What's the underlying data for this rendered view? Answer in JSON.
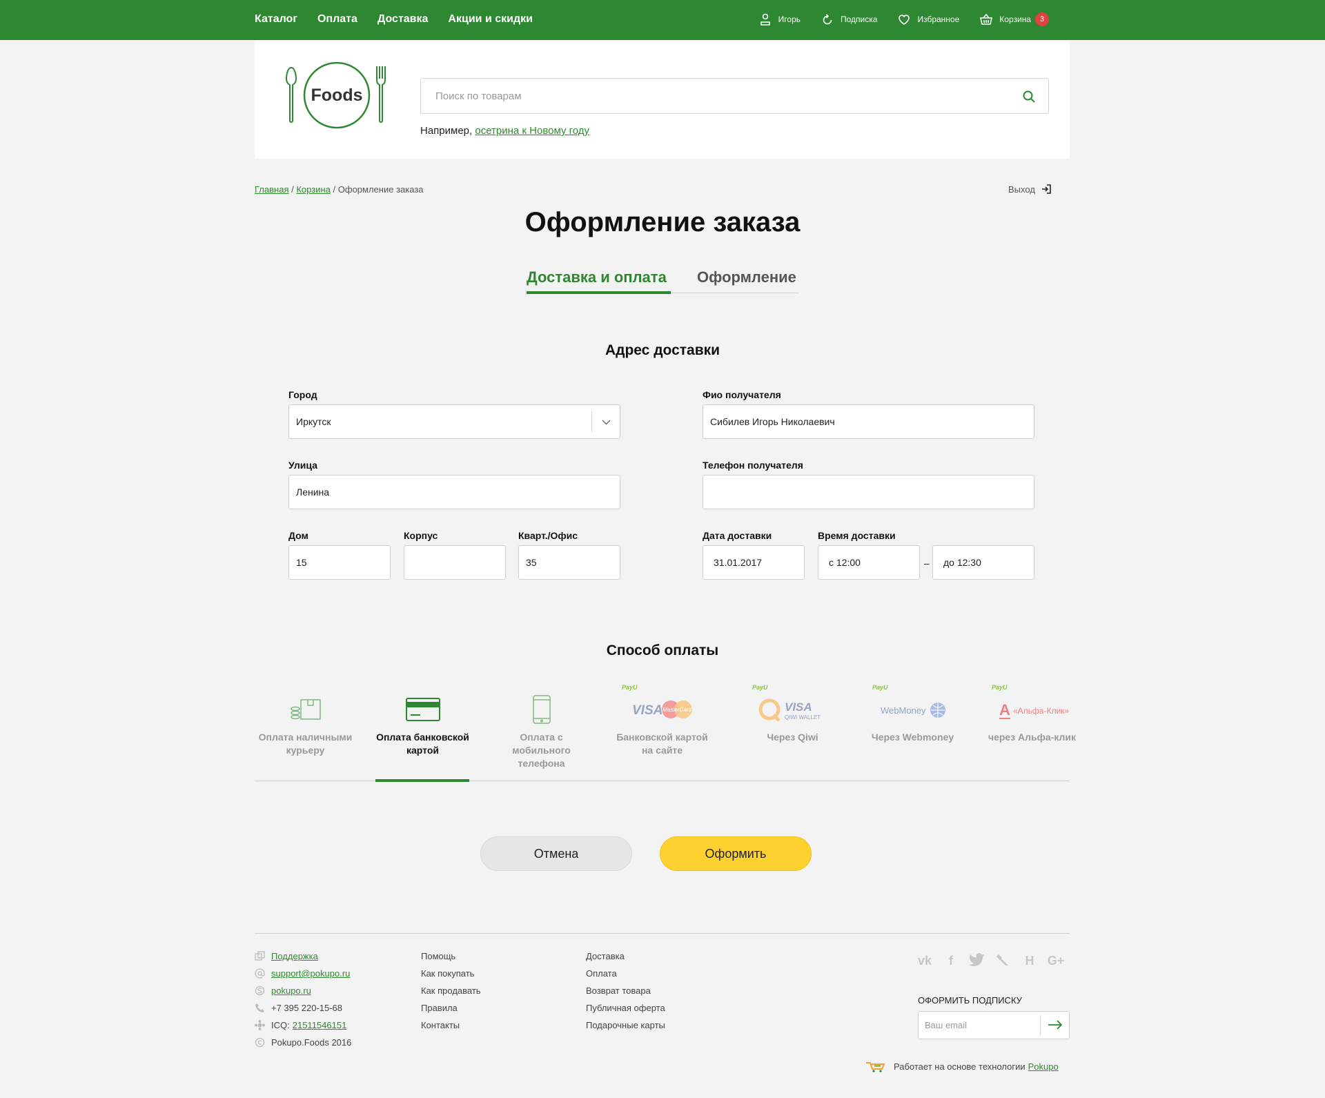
{
  "topbar": {
    "nav": [
      "Каталог",
      "Оплата",
      "Доставка",
      "Акции и скидки"
    ],
    "user": "Игорь",
    "subscription": "Подписка",
    "favorites": "Избранное",
    "cart": "Корзина",
    "cart_count": "3"
  },
  "header": {
    "logo_text": "Foods",
    "search_placeholder": "Поиск по товарам",
    "example_prefix": "Например,",
    "example_link": "осетрина к Новому году"
  },
  "breadcrumb": {
    "home": "Главная",
    "cart": "Корзина",
    "current": "Оформление заказа",
    "sep": "/"
  },
  "logout": "Выход",
  "page_title": "Оформление заказа",
  "steps": [
    "Доставка и оплата",
    "Оформление"
  ],
  "address": {
    "heading": "Адрес доставки",
    "city_label": "Город",
    "city_value": "Иркутск",
    "recipient_label": "Фио получателя",
    "recipient_value": "Сибилев Игорь Николаевич",
    "street_label": "Улица",
    "street_value": "Ленина",
    "phone_label": "Телефон получателя",
    "phone_value": "",
    "house_label": "Дом",
    "house_value": "15",
    "building_label": "Корпус",
    "building_value": "",
    "apt_label": "Кварт./Офис",
    "apt_value": "35",
    "date_label": "Дата доставки",
    "date_value": "31.01.2017",
    "time_label": "Время доставки",
    "time_from": "с 12:00",
    "time_sep": "–",
    "time_to": "до 12:30"
  },
  "payment": {
    "heading": "Способ оплаты",
    "methods": [
      {
        "label": "Оплата наличными курьеру",
        "icon": "cash-icon"
      },
      {
        "label": "Оплата банковской картой",
        "icon": "card-icon",
        "active": true
      },
      {
        "label": "Оплата с мобильного телефона",
        "icon": "mobile-icon"
      },
      {
        "label": "Банковской картой на сайте",
        "icon": "visa-mastercard-logo",
        "payu": "PayU"
      },
      {
        "label": "Через Qiwi",
        "icon": "qiwi-logo",
        "payu": "PayU"
      },
      {
        "label": "Через Webmoney",
        "icon": "webmoney-logo",
        "payu": "PayU"
      },
      {
        "label": "через Альфа-клик",
        "icon": "alfa-click-logo",
        "payu": "PayU"
      }
    ],
    "logos": {
      "visa": "VISA",
      "mastercard": "MasterCard",
      "qiwi_visa": "VISA",
      "qiwi_wallet": "QIWI WALLET",
      "webmoney": "WebMoney",
      "alfa": "«Альфа-Клик»"
    }
  },
  "buttons": {
    "cancel": "Отмена",
    "submit": "Оформить"
  },
  "footer": {
    "support": "Поддержка",
    "email": "support@pokupo.ru",
    "skype": "pokupo.ru",
    "phone": "+7 395 220-15-68",
    "icq_prefix": "ICQ:",
    "icq": "21511546151",
    "copyright": "Pokupo.Foods 2016",
    "col2": [
      "Помощь",
      "Как покупать",
      "Как продавать",
      "Правила",
      "Контакты"
    ],
    "col3": [
      "Доставка",
      "Оплата",
      "Возврат товара",
      "Публичная оферта",
      "Подарочные карты"
    ],
    "social": [
      "vk-icon",
      "facebook-icon",
      "twitter-icon",
      "livejournal-icon",
      "habr-icon",
      "google-plus-icon"
    ],
    "subscribe_title": "Оформить подписку",
    "subscribe_placeholder": "Ваш email",
    "powered_text": "Работает на основе технологии",
    "powered_link": "Pokupo"
  },
  "colors": {
    "brand_green": "#2e8731",
    "accent_yellow": "#fed12f",
    "badge_red": "#e04242"
  }
}
